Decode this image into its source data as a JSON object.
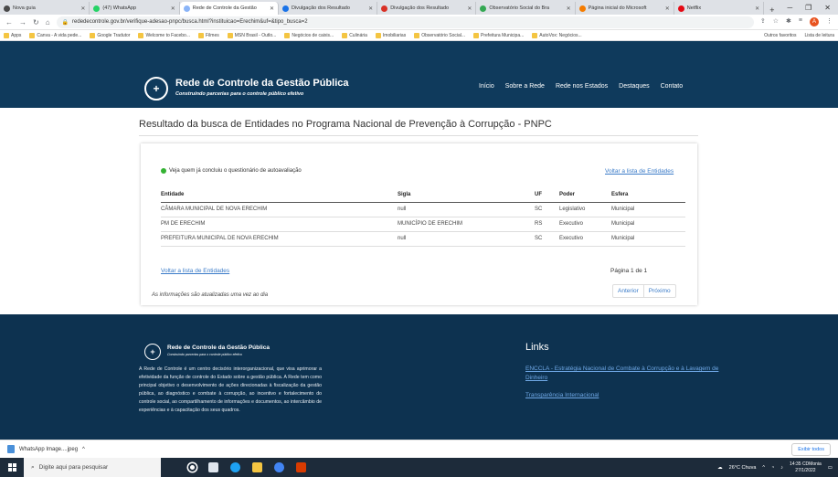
{
  "browser": {
    "tabs": [
      {
        "label": "Nova guia",
        "color": "#4a4a4a"
      },
      {
        "label": "(47) WhatsApp",
        "color": "#25d366"
      },
      {
        "label": "Rede de Controle da Gestão",
        "color": "#8ab4f8"
      },
      {
        "label": "Divulgação dos Resultado",
        "color": "#1a73e8"
      },
      {
        "label": "Divulgação dos Resultado",
        "color": "#d93025"
      },
      {
        "label": "Observatório Social do Bra",
        "color": "#34a853"
      },
      {
        "label": "Página inicial do Microsoft",
        "color": "#f57c00"
      },
      {
        "label": "Netflix",
        "color": "#e50914"
      }
    ],
    "active_tab": 2,
    "new_tab": "+",
    "url": "rededecontrole.gov.br/verifique-adesao-pnpc/busca.html?instituicao=Erechim&uf=&tipo_busca=2",
    "bookmarks": [
      "Apps",
      "Canva - A vida pede...",
      "Google Tradutor",
      "Welcome to Facebo...",
      "Filmes",
      "MSN Brasil - Outlo...",
      "Negócios de caixis...",
      "Culinária",
      "Imobiliarias",
      "Observatório Social...",
      "Prefeitura Municipa...",
      "AutoVox: Negócios..."
    ],
    "bookmarks_right": [
      "Outros favoritos",
      "Lista de leitura"
    ]
  },
  "site": {
    "brand_title": "Rede de Controle da Gestão Pública",
    "brand_subtitle": "Construindo parcerias para o controle público efetivo",
    "nav": [
      "Início",
      "Sobre a Rede",
      "Rede nos Estados",
      "Destaques",
      "Contato"
    ]
  },
  "main": {
    "page_title": "Resultado da busca de Entidades no Programa Nacional de Prevenção à Corrupção - PNPC",
    "hint": "Veja quem já concluiu o questionário de autoavaliação",
    "back_link": "Voltar a lista de Entidades",
    "columns": [
      "Entidade",
      "Sigla",
      "UF",
      "Poder",
      "Esfera"
    ],
    "rows": [
      [
        "CÂMARA MUNICIPAL DE NOVA ERECHIM",
        "null",
        "SC",
        "Legislativo",
        "Municipal"
      ],
      [
        "PM DE ERECHIM",
        "MUNICÍPIO DE ERECHIM",
        "RS",
        "Executivo",
        "Municipal"
      ],
      [
        "PREFEITURA MUNICIPAL DE NOVA ERECHIM",
        "null",
        "SC",
        "Executivo",
        "Municipal"
      ]
    ],
    "page_info": "Página 1 de 1",
    "note": "As informações são atualizadas uma vez ao dia",
    "prev": "Anterior",
    "next": "Próximo"
  },
  "footer": {
    "title": "Rede de Controle da Gestão Pública",
    "subtitle": "Construindo parcerias para o controle público efetivo",
    "text": "A Rede de Controle é um centro decisório interorganizacional, que visa aprimorar a efetividade da função de controle do Estado sobre a gestão pública. A Rede tem como principal objetivo o desenvolvimento de ações direcionadas à fiscalização da gestão pública, ao diagnóstico e combate à corrupção, ao incentivo e fortalecimento do controle social, ao compartilhamento de informações e documentos, ao intercâmbio de experiências e à capacitação dos seus quadros.",
    "links_title": "Links",
    "link1": "ENCCLA - Estratégia Nacional de Combate à Corrupção e à Lavagem de Dinheiro",
    "link2": "Transparência Internacional"
  },
  "downloads": {
    "file": "WhatsApp Image....jpeg",
    "show_all": "Exibir todos"
  },
  "taskbar": {
    "search_placeholder": "Digite aqui para pesquisar",
    "weather": "26°C Chuva",
    "time": "14:35 CDMonia",
    "date": "27/1/2022"
  }
}
